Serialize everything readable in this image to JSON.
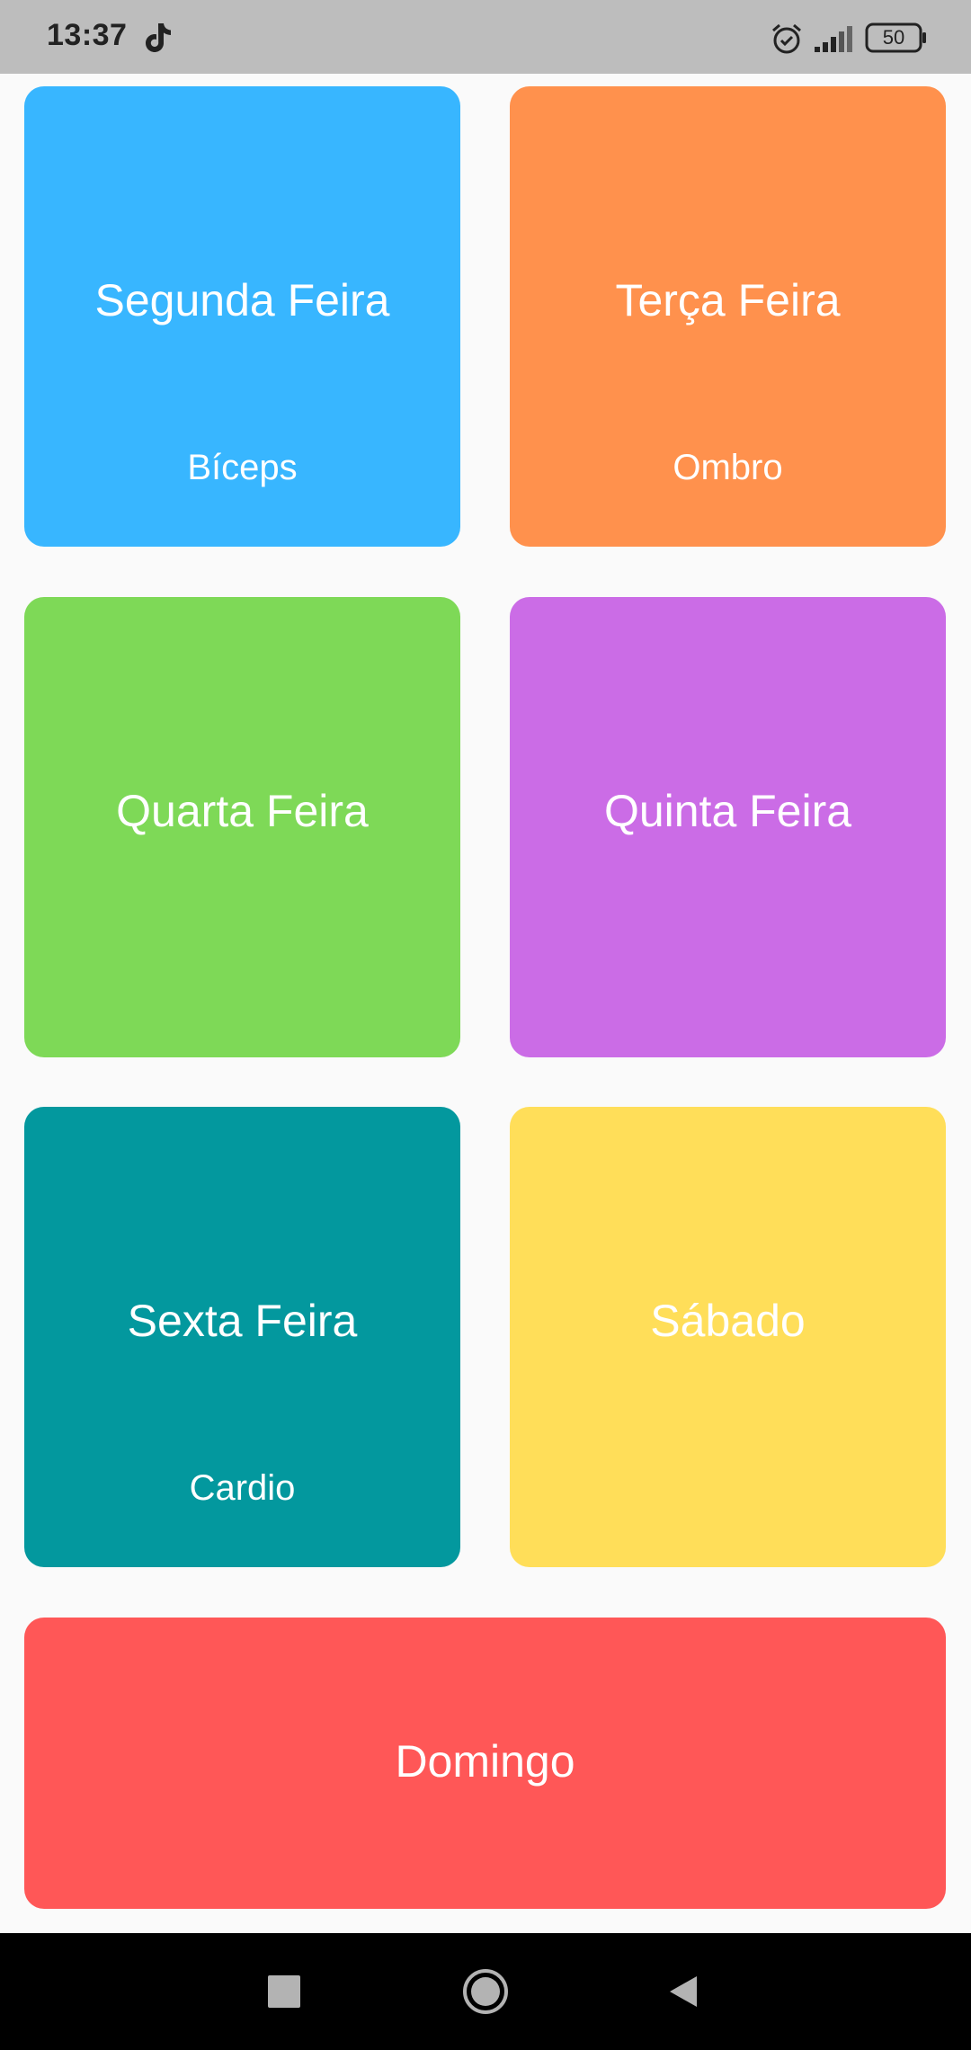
{
  "status_bar": {
    "time": "13:37",
    "battery": "50",
    "icons": [
      "tiktok-icon",
      "alarm-icon",
      "signal-icon",
      "battery-icon"
    ]
  },
  "tiles": [
    {
      "day": "Segunda Feira",
      "muscle": "Bíceps",
      "color": "#38b6ff"
    },
    {
      "day": "Terça Feira",
      "muscle": "Ombro",
      "color": "#ff914d"
    },
    {
      "day": "Quarta Feira",
      "muscle": "",
      "color": "#7ed957"
    },
    {
      "day": "Quinta Feira",
      "muscle": "",
      "color": "#cb6ce6"
    },
    {
      "day": "Sexta Feira",
      "muscle": "Cardio",
      "color": "#03989e"
    },
    {
      "day": "Sábado",
      "muscle": "",
      "color": "#ffde59"
    },
    {
      "day": "Domingo",
      "muscle": "",
      "color": "#ff5757"
    }
  ],
  "nav_bar": {
    "buttons": [
      "recents-square-icon",
      "home-circle-icon",
      "back-triangle-icon"
    ]
  }
}
